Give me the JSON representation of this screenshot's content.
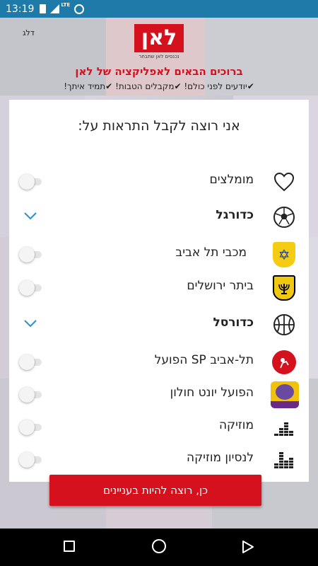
{
  "status_bar": {
    "time": "13:19",
    "network": "LTE",
    "icons": [
      "sim-card-icon",
      "signal-icon",
      "alarm-icon"
    ]
  },
  "header": {
    "skip": "דלג",
    "logo_text": "לאן",
    "logo_subtitle": "נכנסים לאן שתבחר",
    "welcome": "ברוכים הבאים לאפליקציה של לאן",
    "benefits": [
      {
        "check": "✔",
        "text": "יודעים לפני כולם!"
      },
      {
        "check": "✔",
        "text": "מקבלים הטבות!"
      },
      {
        "check": "✔",
        "text": "תמיד איתך!"
      }
    ]
  },
  "card": {
    "title": "אני רוצה לקבל התראות על:",
    "items": [
      {
        "label": "מומלצים",
        "icon": "heart-icon",
        "control": "toggle",
        "on": false
      },
      {
        "label": "כדורגל",
        "icon": "soccer-ball-icon",
        "control": "chevron",
        "expanded": true
      },
      {
        "label": "מכבי תל אביב",
        "icon": "maccabi-tel-aviv-logo",
        "control": "toggle",
        "on": false
      },
      {
        "label": "ביתר ירושלים",
        "icon": "beitar-jerusalem-logo",
        "control": "toggle",
        "on": false
      },
      {
        "label": "כדורסל",
        "icon": "basketball-icon",
        "control": "chevron",
        "expanded": true
      },
      {
        "label": "תל-אביב SP הפועל",
        "icon": "hapoel-tel-aviv-logo",
        "control": "toggle",
        "on": false
      },
      {
        "label": "הפועל יונט חולון",
        "icon": "hapoel-holon-logo",
        "control": "toggle",
        "on": false
      },
      {
        "label": "מוזיקה",
        "icon": "equalizer-icon",
        "control": "toggle",
        "on": false
      },
      {
        "label": "לנסיון מוזיקה",
        "icon": "equalizer-icon",
        "control": "toggle",
        "on": false
      }
    ]
  },
  "cta": {
    "label": "כן, רוצה להיות בעניינים"
  },
  "nav_bar": {
    "icons": [
      "recents-icon",
      "home-icon",
      "back-icon"
    ]
  },
  "colors": {
    "brand_red": "#d6111e",
    "status_bar": "#1e7aa8",
    "chevron_blue": "#2a8fd0"
  }
}
